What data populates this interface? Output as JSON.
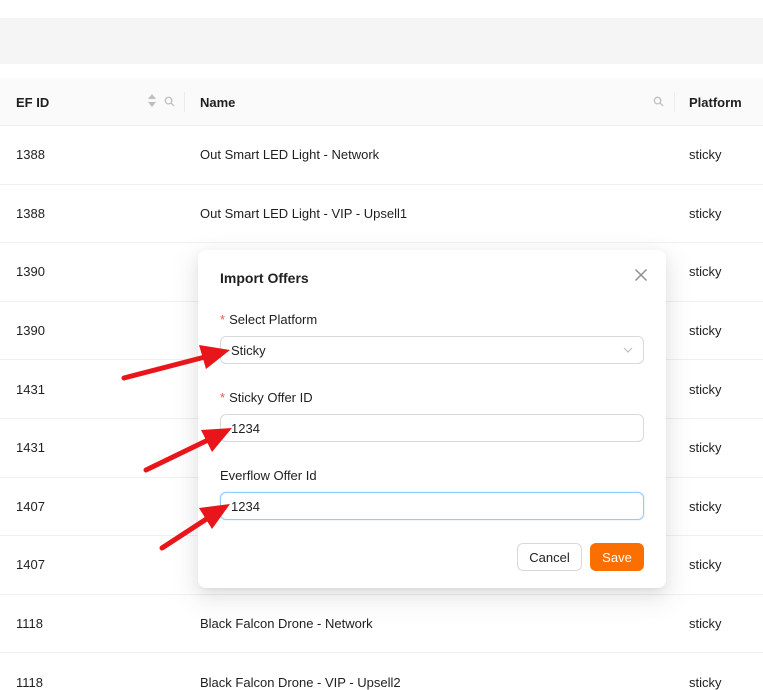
{
  "table": {
    "columns": {
      "efid": "EF ID",
      "name": "Name",
      "platform": "Platform"
    },
    "rows": [
      {
        "efid": "1388",
        "name": "Out Smart LED Light - Network",
        "platform": "sticky"
      },
      {
        "efid": "1388",
        "name": "Out Smart LED Light - VIP - Upsell1",
        "platform": "sticky"
      },
      {
        "efid": "1390",
        "name": "",
        "platform": "sticky"
      },
      {
        "efid": "1390",
        "name": "",
        "platform": "sticky"
      },
      {
        "efid": "1431",
        "name": "",
        "platform": "sticky"
      },
      {
        "efid": "1431",
        "name": "",
        "platform": "sticky"
      },
      {
        "efid": "1407",
        "name": "",
        "platform": "sticky"
      },
      {
        "efid": "1407",
        "name": "",
        "platform": "sticky"
      },
      {
        "efid": "1118",
        "name": "Black Falcon Drone - Network",
        "platform": "sticky"
      },
      {
        "efid": "1118",
        "name": "Black Falcon Drone - VIP - Upsell2",
        "platform": "sticky"
      }
    ]
  },
  "modal": {
    "title": "Import Offers",
    "required_mark": "*",
    "platform_label": "Select Platform",
    "platform_value": "Sticky",
    "sticky_id_label": "Sticky Offer ID",
    "sticky_id_value": "1234",
    "everflow_id_label": "Everflow Offer Id",
    "everflow_id_value": "1234",
    "cancel_label": "Cancel",
    "save_label": "Save"
  },
  "colors": {
    "primary": "#fa6f00",
    "required": "#ff4d4f",
    "annotation_arrow": "#e8161a"
  },
  "icons": {
    "sort": "sort-icon",
    "search": "search-icon",
    "close": "close-icon",
    "chevron": "chevron-down-icon"
  }
}
